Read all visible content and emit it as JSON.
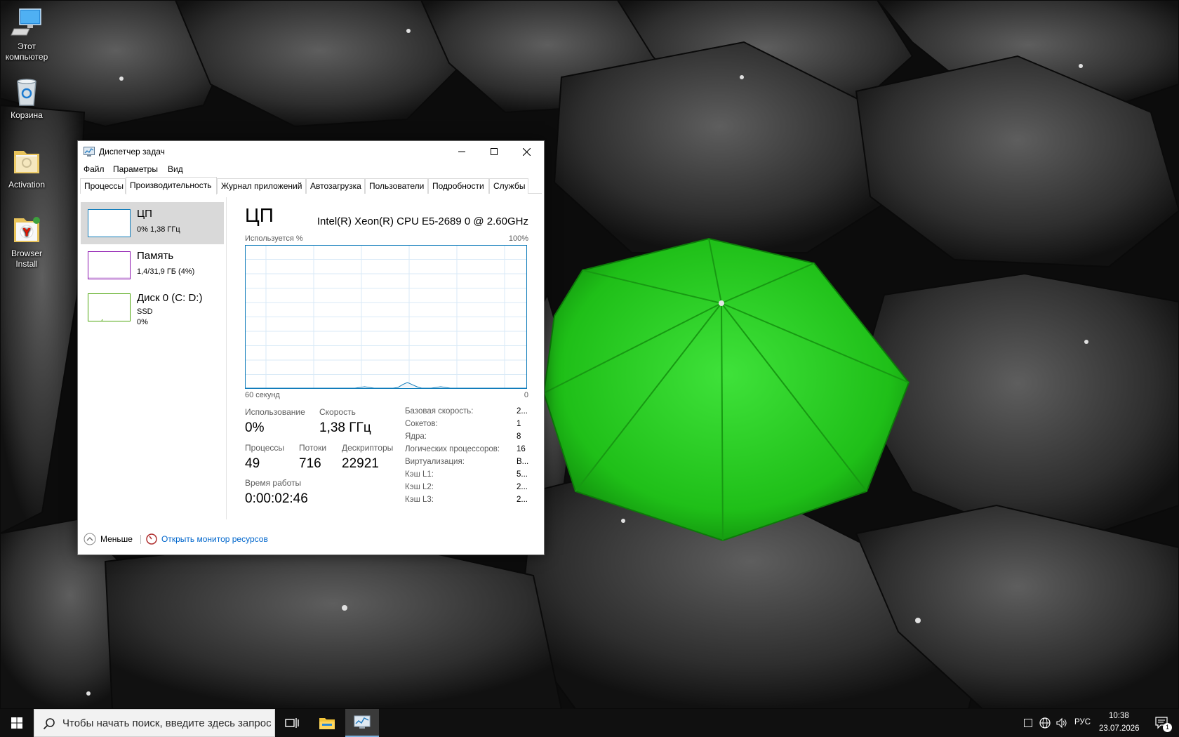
{
  "desktop": {
    "icons": [
      {
        "label_line1": "Этот",
        "label_line2": "компьютер",
        "icon": "this-pc-icon"
      },
      {
        "label_line1": "Корзина",
        "label_line2": "",
        "icon": "recycle-bin-icon"
      },
      {
        "label_line1": "Activation",
        "label_line2": "",
        "icon": "activation-folder-icon"
      },
      {
        "label_line1": "Browser",
        "label_line2": "Install",
        "icon": "browser-install-icon"
      }
    ]
  },
  "window": {
    "title": "Диспетчер задач",
    "menu": [
      "Файл",
      "Параметры",
      "Вид"
    ],
    "tabs": [
      "Процессы",
      "Производительность",
      "Журнал приложений",
      "Автозагрузка",
      "Пользователи",
      "Подробности",
      "Службы"
    ],
    "active_tab": "Производительность"
  },
  "left_panel": {
    "items": [
      {
        "name": "ЦП",
        "line1": "0%  1,38 ГГц",
        "line2": "",
        "color": "#117dbb"
      },
      {
        "name": "Память",
        "line1": "1,4/31,9 ГБ (4%)",
        "line2": "",
        "color": "#8b12ae"
      },
      {
        "name": "Диск 0 (C: D:)",
        "line1": "SSD",
        "line2": "0%",
        "color": "#4da60c"
      }
    ]
  },
  "cpu": {
    "title": "ЦП",
    "model": "Intel(R) Xeon(R) CPU E5-2689 0 @ 2.60GHz",
    "graph_label_left": "Используется %",
    "graph_label_right": "100%",
    "graph_time_left": "60 секунд",
    "graph_time_right": "0",
    "utilization_label": "Использование",
    "utilization": "0%",
    "speed_label": "Скорость",
    "speed": "1,38 ГГц",
    "processes_label": "Процессы",
    "processes": "49",
    "threads_label": "Потоки",
    "threads": "716",
    "handles_label": "Дескрипторы",
    "handles": "22921",
    "uptime_label": "Время работы",
    "uptime": "0:00:02:46",
    "specs": [
      {
        "label": "Базовая скорость:",
        "value": "2..."
      },
      {
        "label": "Сокетов:",
        "value": "1"
      },
      {
        "label": "Ядра:",
        "value": "8"
      },
      {
        "label": "Логических процессоров:",
        "value": "16"
      },
      {
        "label": "Виртуализация:",
        "value": "В..."
      },
      {
        "label": "Кэш L1:",
        "value": "5..."
      },
      {
        "label": "Кэш L2:",
        "value": "2..."
      },
      {
        "label": "Кэш L3:",
        "value": "2..."
      }
    ],
    "graph_line_color": "#117dbb",
    "history_percent": [
      0,
      0,
      0,
      0,
      0,
      0,
      0,
      0,
      0,
      0,
      0,
      0,
      0,
      0,
      0,
      0,
      0,
      0,
      0,
      0,
      0,
      0,
      0,
      0,
      0.5,
      1,
      0.5,
      0,
      0,
      0,
      0,
      0,
      0.5,
      2.5,
      4,
      2.5,
      1,
      0,
      0,
      0,
      0.5,
      1,
      0.5,
      0,
      0,
      0,
      0,
      0,
      0,
      0,
      0,
      0,
      0,
      0,
      0,
      0,
      0,
      0,
      0,
      0
    ]
  },
  "footer": {
    "less_label": "Меньше",
    "resmon_label": "Открыть монитор ресурсов"
  },
  "taskbar": {
    "search_placeholder": "Чтобы начать поиск, введите здесь запрос",
    "language": "РУС",
    "time": "10:38",
    "date": "23.07.2026",
    "notification_count": "1"
  },
  "colors": {
    "accent_link": "#0066cc",
    "selected_item": "#d9d9d9",
    "taskbar": "#101010"
  }
}
